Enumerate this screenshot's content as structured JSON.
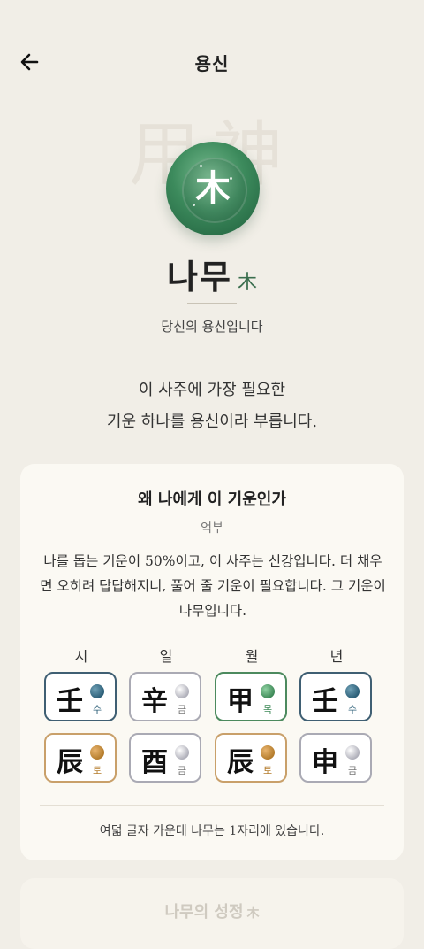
{
  "header": {
    "title": "용신",
    "back_icon": "arrow-left-icon"
  },
  "watermark": "用神",
  "hero": {
    "orb_char": "木",
    "name": "나무",
    "name_hanja": "木",
    "subtitle": "당신의 용신입니다"
  },
  "description": {
    "line1": "이 사주에 가장 필요한",
    "line2": "기운 하나를 용신이라 부릅니다."
  },
  "card": {
    "title": "왜 나에게 이 기운인가",
    "divider_label": "억부",
    "body": "나를 돕는 기운이 50%이고, 이 사주는 신강입니다. 더 채우면 오히려 답답해지니, 풀어 줄 기운이 필요합니다. 그 기운이 나무입니다.",
    "pillar_headers": [
      "시",
      "일",
      "월",
      "년"
    ],
    "stems": [
      {
        "char": "壬",
        "element": "수",
        "type": "water"
      },
      {
        "char": "辛",
        "element": "금",
        "type": "metal"
      },
      {
        "char": "甲",
        "element": "목",
        "type": "wood"
      },
      {
        "char": "壬",
        "element": "수",
        "type": "water"
      }
    ],
    "branches": [
      {
        "char": "辰",
        "element": "토",
        "type": "earth"
      },
      {
        "char": "酉",
        "element": "금",
        "type": "metal"
      },
      {
        "char": "辰",
        "element": "토",
        "type": "earth"
      },
      {
        "char": "申",
        "element": "금",
        "type": "metal"
      }
    ],
    "footnote": "여덟 글자 가운데 나무는 1자리에 있습니다."
  },
  "next_section": {
    "title": "나무의 성정",
    "hanja": "木"
  },
  "colors": {
    "background": "#f1eee7",
    "card": "#fbf9f3",
    "wood": "#3f8a58",
    "water": "#2c5f78",
    "metal": "#aaaab4",
    "earth": "#c9a06a"
  }
}
